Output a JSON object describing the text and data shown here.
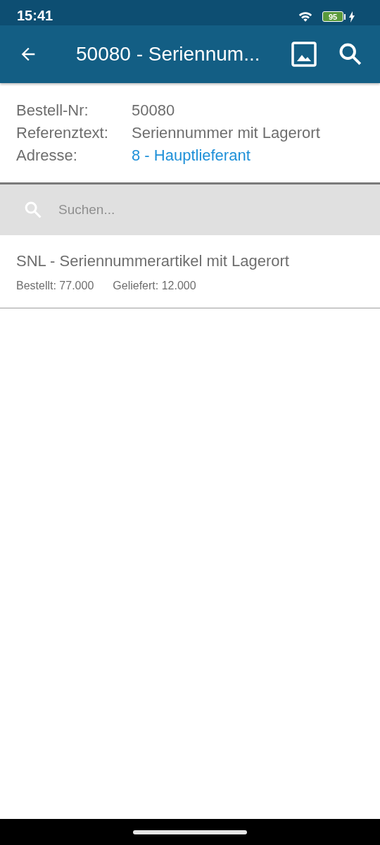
{
  "status_bar": {
    "time": "15:41",
    "battery": "95"
  },
  "app_bar": {
    "title": "50080 - Seriennum..."
  },
  "details": [
    {
      "label": "Bestell-Nr:",
      "value": "50080",
      "kind": "text"
    },
    {
      "label": "Referenztext:",
      "value": "Seriennummer mit Lagerort",
      "kind": "text"
    },
    {
      "label": "Adresse:",
      "value": "8 - Hauptlieferant",
      "kind": "link"
    }
  ],
  "search": {
    "placeholder": "Suchen..."
  },
  "items": [
    {
      "title": "SNL - Seriennummerartikel mit Lagerort",
      "ordered": "Bestellt: 77.000",
      "delivered": "Geliefert: 12.000"
    }
  ]
}
